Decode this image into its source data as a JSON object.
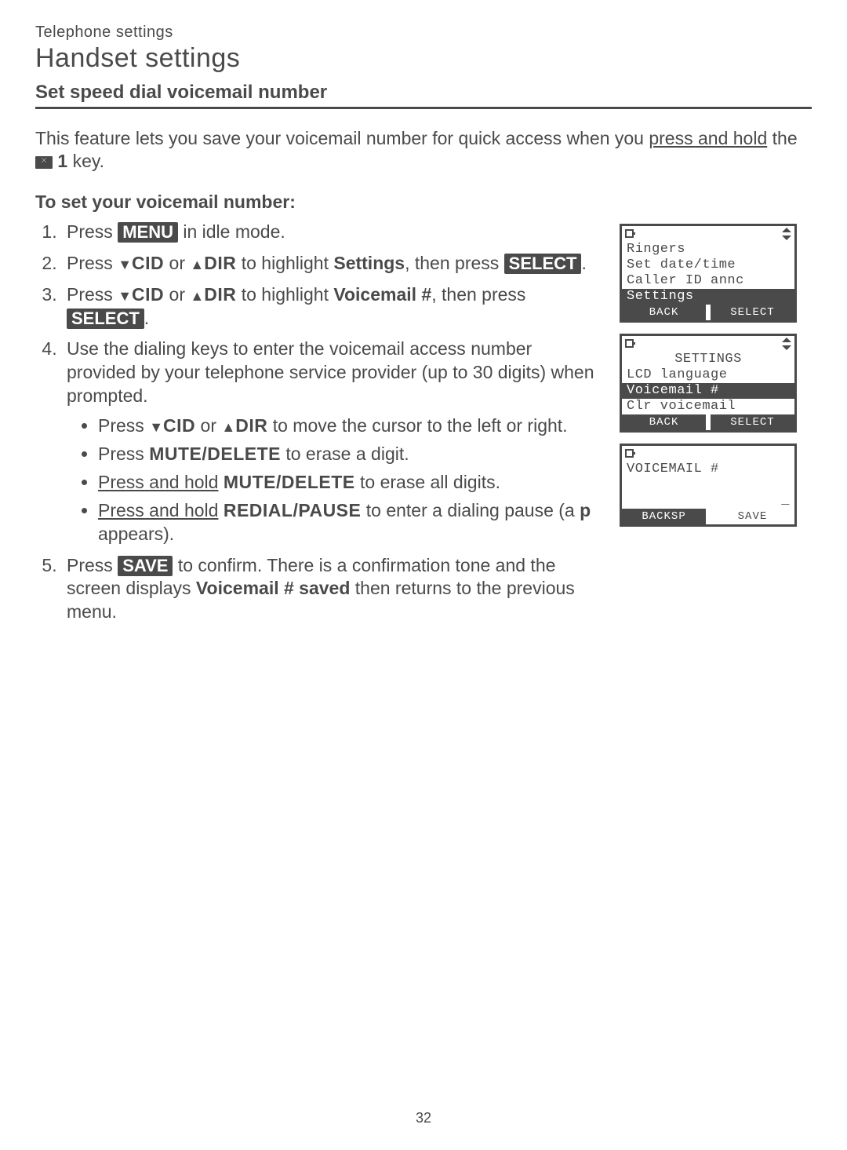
{
  "breadcrumb": "Telephone settings",
  "page_title": "Handset settings",
  "section_heading": "Set speed dial voicemail number",
  "intro": {
    "part1": "This feature lets you save your voicemail number for quick access when you ",
    "underline1": "press and hold",
    "part2": " the ",
    "key1": "1",
    "part3": " key."
  },
  "sub_heading": "To set your voicemail number:",
  "steps": {
    "s1a": "Press ",
    "menu_badge": "MENU",
    "s1b": " in idle mode.",
    "s2a": "Press ",
    "cid": "CID",
    "or": " or ",
    "dir": "DIR",
    "s2b": " to highlight ",
    "settings": "Settings",
    "thenpress": ", then press ",
    "select_badge": "SELECT",
    "period": ".",
    "s3b": " to highlight ",
    "voicemail_num": "Voicemail #",
    "s4": "Use the dialing keys to enter the voicemail access number provided by your telephone service provider (up to 30 digits) when prompted.",
    "b1a": "Press ",
    "b1b": " to move the cursor to the left or right.",
    "b2a": "Press ",
    "mute_delete": "MUTE/DELETE",
    "b2b": " to erase a digit.",
    "b3a": "Press and hold",
    "b3b": " to erase all digits.",
    "b4a": "Press and hold",
    "redial_pause": "REDIAL/PAUSE",
    "b4b": " to enter a dialing pause (a ",
    "p_char": "p",
    "b4c": " appears).",
    "s5a": "Press ",
    "save_badge": "SAVE",
    "s5b": " to confirm. There is a confirmation tone and the screen displays ",
    "vm_saved": "Voicemail # saved",
    "s5c": " then returns to the previous menu."
  },
  "lcd1": {
    "lines": [
      "Ringers",
      "Set date/time",
      "Caller ID annc",
      "Settings"
    ],
    "highlight_index": 3,
    "soft_left": "BACK",
    "soft_right": "SELECT"
  },
  "lcd2": {
    "title": "SETTINGS",
    "lines": [
      "LCD language",
      "Voicemail #",
      "Clr voicemail"
    ],
    "highlight_index": 1,
    "soft_left": "BACK",
    "soft_right": "SELECT"
  },
  "lcd3": {
    "title": "VOICEMAIL #",
    "cursor": "_",
    "soft_left": "BACKSP",
    "soft_right": "SAVE"
  },
  "page_number": "32"
}
